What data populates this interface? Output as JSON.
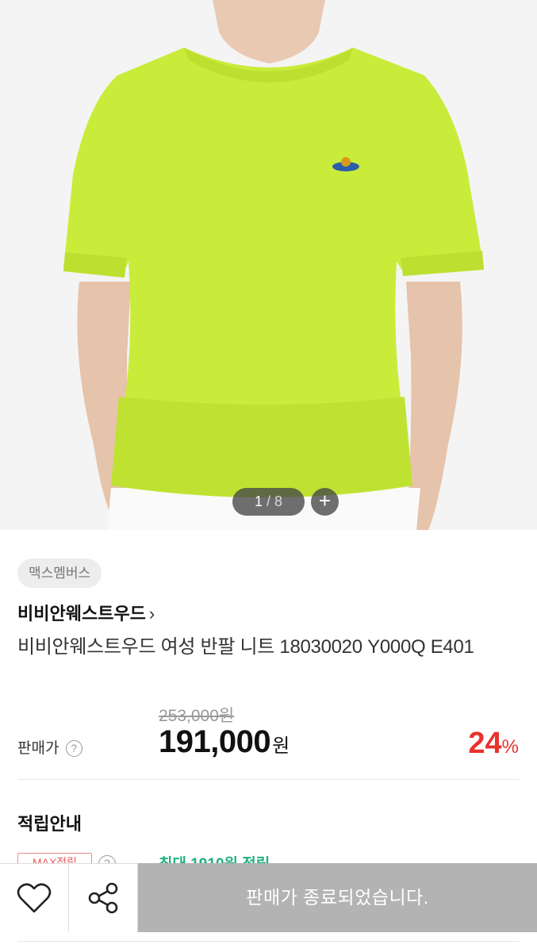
{
  "gallery": {
    "current": "1",
    "separator": "/",
    "total": "8",
    "zoom_label": "+",
    "shirt_color": "#c9ec3a",
    "background_color": "#f4f4f4"
  },
  "product": {
    "member_badge": "맥스멤버스",
    "brand": "비비안웨스트우드",
    "brand_chevron": "›",
    "title": "비비안웨스트우드 여성 반팔 니트 18030020 Y000Q E401"
  },
  "pricing": {
    "original_price": "253,000원",
    "label": "판매가",
    "help_icon": "?",
    "price": "191,000",
    "currency": "원",
    "discount": "24",
    "discount_unit": "%",
    "discount_color": "#e8322c"
  },
  "points": {
    "section_title": "적립안내",
    "max_badge": "MAX적립",
    "help_icon": "?",
    "text": "최대 1910원 적립",
    "text_color": "#23b07d"
  },
  "bottom_bar": {
    "wish_icon": "heart-icon",
    "share_icon": "share-icon",
    "soldout_label": "판매가 종료되었습니다."
  }
}
